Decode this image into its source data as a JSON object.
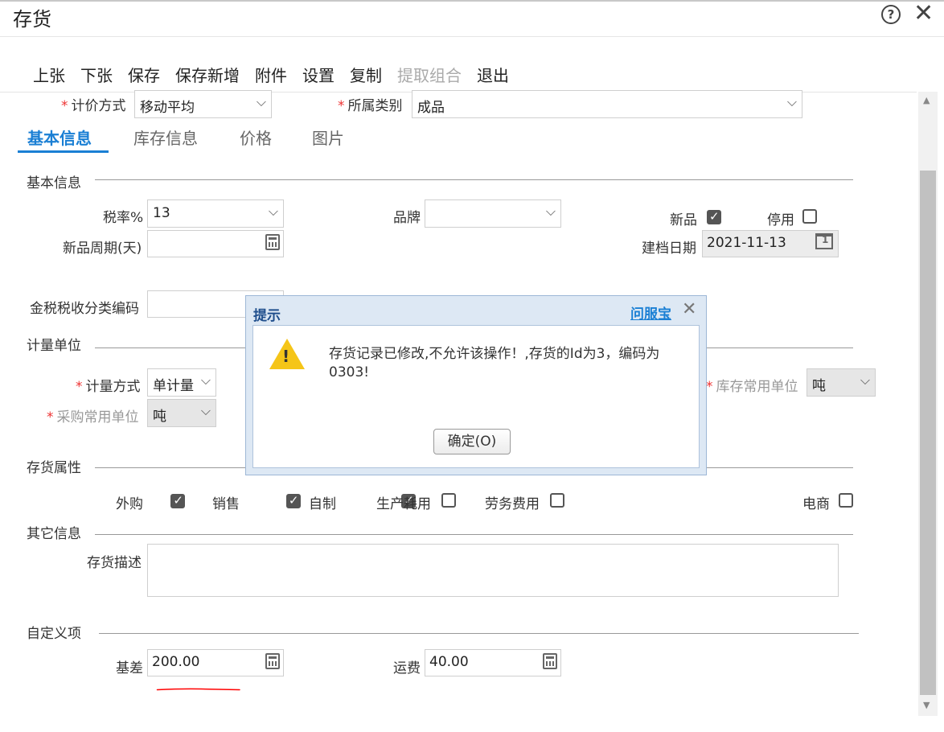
{
  "window": {
    "title": "存货"
  },
  "toolbar": {
    "items": [
      {
        "label": "上张"
      },
      {
        "label": "下张"
      },
      {
        "label": "保存"
      },
      {
        "label": "保存新增"
      },
      {
        "label": "附件"
      },
      {
        "label": "设置"
      },
      {
        "label": "复制"
      },
      {
        "label": "提取组合"
      },
      {
        "label": "退出"
      }
    ]
  },
  "top_fields": {
    "pricing_label": "计价方式",
    "pricing_value": "移动平均",
    "category_label": "所属类别",
    "category_value": "成品"
  },
  "tabs": [
    "基本信息",
    "库存信息",
    "价格",
    "图片"
  ],
  "basic": {
    "section": "基本信息",
    "tax_label": "税率%",
    "tax_value": "13",
    "brand_label": "品牌",
    "brand_value": "",
    "new_label": "新品",
    "disabled_label": "停用",
    "cycle_label": "新品周期(天)",
    "cycle_value": "",
    "date_label": "建档日期",
    "date_value": "2021-11-13",
    "tax_code_label": "金税税收分类编码",
    "tax_code_value": ""
  },
  "units": {
    "section": "计量单位",
    "method_label": "计量方式",
    "method_value": "单计量",
    "purchase_label": "采购常用单位",
    "purchase_value": "吨",
    "stock_label": "库存常用单位",
    "stock_value": "吨"
  },
  "attrs": {
    "section": "存货属性",
    "items": [
      {
        "label": "外购",
        "checked": true
      },
      {
        "label": "销售",
        "checked": true
      },
      {
        "label": "自制",
        "checked": true
      },
      {
        "label": "生产耗用",
        "checked": false
      },
      {
        "label": "劳务费用",
        "checked": false
      },
      {
        "label": "电商",
        "checked": false
      }
    ]
  },
  "other": {
    "section": "其它信息",
    "desc_label": "存货描述",
    "desc_value": ""
  },
  "custom": {
    "section": "自定义项",
    "base_label": "基差",
    "base_value": "200.00",
    "freight_label": "运费",
    "freight_value": "40.00"
  },
  "dialog": {
    "title": "提示",
    "link": "问服宝",
    "message": "存货记录已修改,不允许该操作！,存货的Id为3，编码为0303!",
    "ok_label": "确定(O)"
  },
  "colors": {
    "accent": "#1a7fd4",
    "required": "#e33333",
    "annotation": "#ff0000"
  }
}
